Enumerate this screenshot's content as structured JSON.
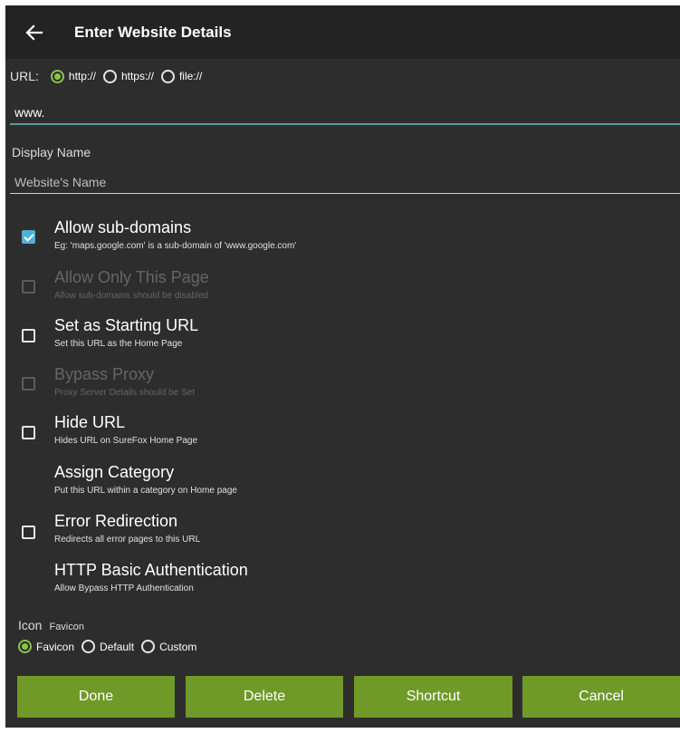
{
  "appbar": {
    "title": "Enter Website Details",
    "back_icon": "arrow-left-icon"
  },
  "url": {
    "label": "URL:",
    "protocols": [
      {
        "label": "http://",
        "selected": true
      },
      {
        "label": "https://",
        "selected": false
      },
      {
        "label": "file://",
        "selected": false
      }
    ],
    "value": "www."
  },
  "display_name": {
    "label": "Display Name",
    "placeholder": "Website's Name"
  },
  "options": [
    {
      "title": "Allow sub-domains",
      "subtitle": "Eg: 'maps.google.com' is a sub-domain of 'www.google.com'",
      "checkbox": true,
      "checked": true,
      "enabled": true
    },
    {
      "title": "Allow Only This Page",
      "subtitle": "Allow sub-domains should be disabled",
      "checkbox": true,
      "checked": false,
      "enabled": false
    },
    {
      "title": "Set as Starting URL",
      "subtitle": "Set this URL as the Home Page",
      "checkbox": true,
      "checked": false,
      "enabled": true
    },
    {
      "title": "Bypass Proxy",
      "subtitle": "Proxy Server Details should be Set",
      "checkbox": true,
      "checked": false,
      "enabled": false
    },
    {
      "title": "Hide URL",
      "subtitle": "Hides URL on SureFox Home Page",
      "checkbox": true,
      "checked": false,
      "enabled": true
    },
    {
      "title": "Assign Category",
      "subtitle": "Put this URL within a category on Home page",
      "checkbox": false,
      "enabled": true
    },
    {
      "title": "Error Redirection",
      "subtitle": "Redirects all error pages to this URL",
      "checkbox": true,
      "checked": false,
      "enabled": true
    },
    {
      "title": "HTTP Basic Authentication",
      "subtitle": "Allow Bypass HTTP Authentication",
      "checkbox": false,
      "enabled": true
    }
  ],
  "icon": {
    "label": "Icon",
    "value": "Favicon",
    "choices": [
      {
        "label": "Favicon",
        "selected": true
      },
      {
        "label": "Default",
        "selected": false
      },
      {
        "label": "Custom",
        "selected": false
      }
    ]
  },
  "buttons": {
    "done": "Done",
    "delete": "Delete",
    "shortcut": "Shortcut",
    "cancel": "Cancel"
  },
  "colors": {
    "accent": "#8bc34a",
    "checkbox": "#4fb1d1",
    "button": "#6f9a28",
    "background": "#2d2d2d",
    "appbar": "#232323"
  }
}
